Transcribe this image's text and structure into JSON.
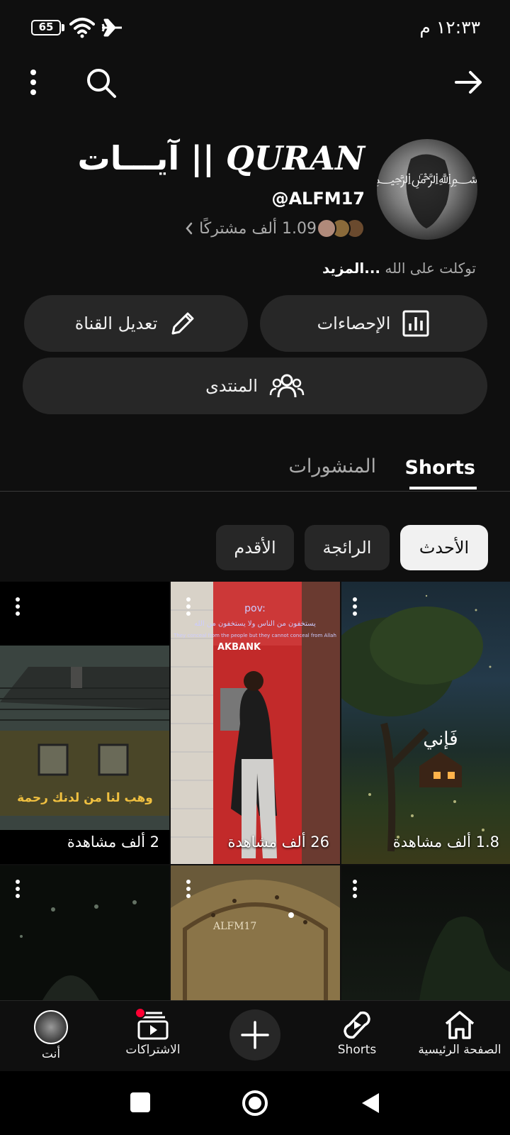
{
  "status_bar": {
    "time": "١٢:٣٣ م",
    "battery": "65"
  },
  "channel": {
    "name_arabic": "آيـــات",
    "name_separator": "||",
    "name_latin": "QURAN",
    "handle": "@ALFM17",
    "subscribers": "1.09 ألف مشتركًا",
    "description": "توكلت على الله",
    "more_label": "...المزيد"
  },
  "buttons": {
    "analytics": "الإحصاءات",
    "edit_channel": "تعديل القناة",
    "community": "المنتدى"
  },
  "tabs": [
    {
      "label": "Shorts"
    },
    {
      "label": "المنشورات"
    }
  ],
  "chips": [
    {
      "label": "الأحدث"
    },
    {
      "label": "الرائجة"
    },
    {
      "label": "الأقدم"
    }
  ],
  "shorts": [
    {
      "views": "1.8 ألف مشاهدة",
      "overlay": "فَإني"
    },
    {
      "views": "26 ألف مشاهدة",
      "overlay_top": "pov:",
      "overlay_ar": "يستخفون من الناس ولا يستخفون من الله",
      "overlay_en": "They conceal from the people but they cannot conceal from Allah",
      "sign": "AKBANK"
    },
    {
      "views": "2 ألف مشاهدة",
      "overlay": "وهب لنا من لدنك رحمة"
    },
    {
      "overlay": ""
    },
    {
      "overlay": "ALFM17"
    },
    {
      "overlay": ""
    }
  ],
  "bottom_nav": [
    {
      "label": "الصفحة الرئيسية",
      "icon": "home-icon"
    },
    {
      "label": "Shorts",
      "icon": "shorts-icon"
    },
    {
      "label": "",
      "icon": "create-icon"
    },
    {
      "label": "الاشتراكات",
      "icon": "subscriptions-icon"
    },
    {
      "label": "أنت",
      "icon": "avatar"
    }
  ],
  "colors": {
    "background": "#0f0f0f",
    "surface": "#272727",
    "secondary_text": "#aaaaaa",
    "notification": "#ff0033"
  }
}
